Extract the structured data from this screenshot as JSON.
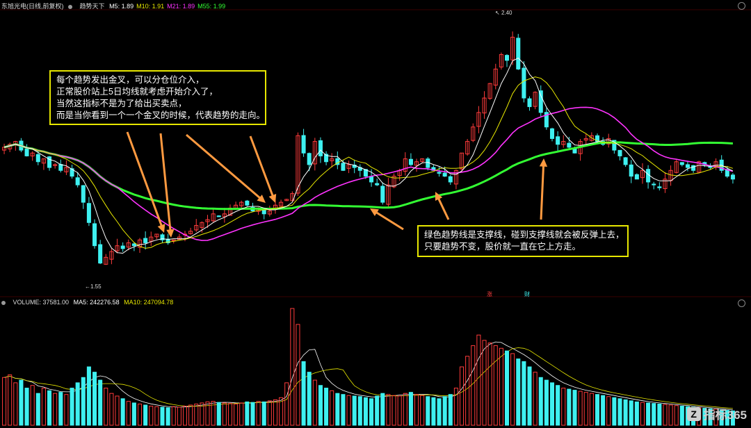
{
  "header": {
    "stock_name": "东旭光电(日线,前复权)",
    "indicator_name": "趋势天下",
    "ma_items": [
      {
        "label": "M5: 1.89",
        "color": "#ffffff"
      },
      {
        "label": "M10: 1.91",
        "color": "#e8e800"
      },
      {
        "label": "M21: 1.89",
        "color": "#ff33ff"
      },
      {
        "label": "M55: 1.99",
        "color": "#33ff33"
      }
    ]
  },
  "volume_header": {
    "volume": "VOLUME: 37581.00",
    "ma5": "MA5: 242276.58",
    "ma10": "MA10: 247094.78"
  },
  "annotations": {
    "box1": [
      "每个趋势发出金叉，可以分仓位介入，",
      "正常股价站上5日均线就考虑开始介入了，",
      "当然这指标不是为了给出买卖点，",
      "而是当你看到一个一个金叉的时候，代表趋势的走向。"
    ],
    "box2": [
      "绿色趋势线是支撑线，碰到支撑线就会被反弹上去，",
      "只要趋势不变，股价就一直在它上方走。"
    ]
  },
  "price_labels": {
    "high": "2.40",
    "low": "1.55"
  },
  "markers": {
    "m1": "涨",
    "m2": "财"
  },
  "watermark": {
    "logo": "Z",
    "text": "指标365"
  },
  "colors": {
    "up": "#ff3b3b",
    "down": "#3ef0f0",
    "m5": "#ffffff",
    "m10": "#e8e800",
    "m21": "#ff33ff",
    "m55": "#33ff33",
    "arrow": "#ff9a40"
  },
  "chart_data": {
    "type": "candlestick",
    "bars": 130,
    "yrange": [
      1.5,
      2.45
    ],
    "high": 2.4,
    "low": 1.55,
    "series": [
      {
        "name": "M5",
        "last": 1.89
      },
      {
        "name": "M10",
        "last": 1.91
      },
      {
        "name": "M21",
        "last": 1.89
      },
      {
        "name": "M55",
        "last": 1.99
      }
    ],
    "close": [
      1.98,
      1.99,
      2.0,
      1.97,
      1.95,
      1.96,
      1.93,
      1.94,
      1.91,
      1.92,
      1.9,
      1.91,
      1.88,
      1.85,
      1.79,
      1.72,
      1.64,
      1.58,
      1.6,
      1.62,
      1.64,
      1.63,
      1.65,
      1.64,
      1.66,
      1.65,
      1.67,
      1.68,
      1.66,
      1.65,
      1.66,
      1.67,
      1.68,
      1.69,
      1.71,
      1.72,
      1.73,
      1.75,
      1.74,
      1.75,
      1.77,
      1.78,
      1.79,
      1.78,
      1.76,
      1.77,
      1.75,
      1.76,
      1.78,
      1.79,
      1.8,
      1.82,
      2.02,
      1.96,
      1.92,
      2.0,
      1.95,
      1.93,
      1.94,
      1.92,
      1.9,
      1.92,
      1.91,
      1.9,
      1.88,
      1.86,
      1.85,
      1.79,
      1.85,
      1.88,
      1.9,
      1.94,
      1.92,
      1.93,
      1.94,
      1.91,
      1.9,
      1.89,
      1.88,
      1.86,
      1.9,
      1.96,
      2.0,
      2.05,
      2.1,
      2.15,
      2.2,
      2.25,
      2.3,
      2.28,
      2.36,
      2.25,
      2.15,
      2.12,
      2.17,
      2.1,
      2.05,
      2.01,
      1.99,
      2.0,
      1.98,
      1.96,
      2.0,
      2.01,
      2.02,
      2.0,
      1.99,
      2.01,
      1.97,
      1.95,
      1.92,
      1.88,
      1.87,
      1.9,
      1.86,
      1.85,
      1.84,
      1.87,
      1.9,
      1.93,
      1.92,
      1.91,
      1.9,
      1.93,
      1.92,
      1.91,
      1.93,
      1.9,
      1.88,
      1.87
    ],
    "volume": [
      90,
      95,
      80,
      85,
      70,
      75,
      60,
      70,
      65,
      60,
      62,
      58,
      70,
      80,
      90,
      110,
      100,
      85,
      70,
      60,
      55,
      50,
      45,
      42,
      40,
      38,
      36,
      35,
      34,
      33,
      35,
      34,
      36,
      38,
      40,
      42,
      44,
      45,
      43,
      42,
      41,
      40,
      42,
      44,
      43,
      45,
      44,
      46,
      48,
      52,
      80,
      220,
      190,
      120,
      100,
      85,
      75,
      70,
      65,
      60,
      58,
      56,
      55,
      54,
      52,
      50,
      55,
      60,
      58,
      56,
      55,
      60,
      62,
      58,
      56,
      54,
      52,
      50,
      54,
      58,
      70,
      110,
      130,
      150,
      170,
      160,
      155,
      150,
      145,
      140,
      135,
      125,
      120,
      110,
      100,
      90,
      85,
      80,
      75,
      70,
      68,
      66,
      64,
      62,
      60,
      58,
      56,
      54,
      52,
      50,
      48,
      46,
      44,
      43,
      42,
      41,
      40,
      39,
      38,
      37,
      36,
      35,
      34,
      33,
      32,
      31,
      30,
      29,
      28,
      27
    ]
  }
}
